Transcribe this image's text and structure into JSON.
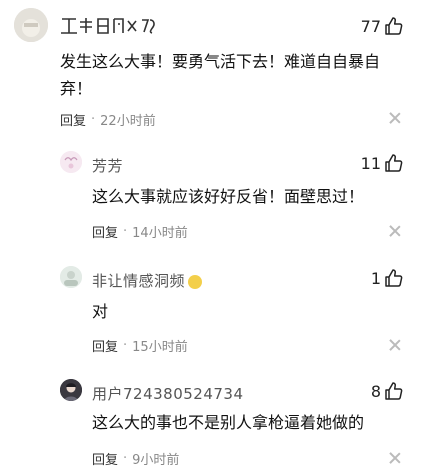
{
  "comments": [
    {
      "username": "",
      "likes": "77",
      "text": "发生这么大事！要勇气活下去！难道自自暴自弃！",
      "reply_label": "回复",
      "separator": "·",
      "time": "22小时前"
    },
    {
      "username": "芳芳",
      "likes": "11",
      "text": "这么大事就应该好好反省！面壁思过！",
      "reply_label": "回复",
      "separator": "·",
      "time": "14小时前"
    },
    {
      "username": "非让情感洞频",
      "likes": "1",
      "text": "对",
      "reply_label": "回复",
      "separator": "·",
      "time": "15小时前"
    },
    {
      "username": "用户724380524734",
      "likes": "8",
      "text": "这么大的事也不是别人拿枪逼着她做的",
      "reply_label": "回复",
      "separator": "·",
      "time": "9小时前"
    }
  ],
  "icons": {
    "like": "thumbs-up-icon",
    "close": "close-icon"
  },
  "colors": {
    "text": "#222222",
    "meta": "#888888",
    "close": "#bbbbbb"
  }
}
